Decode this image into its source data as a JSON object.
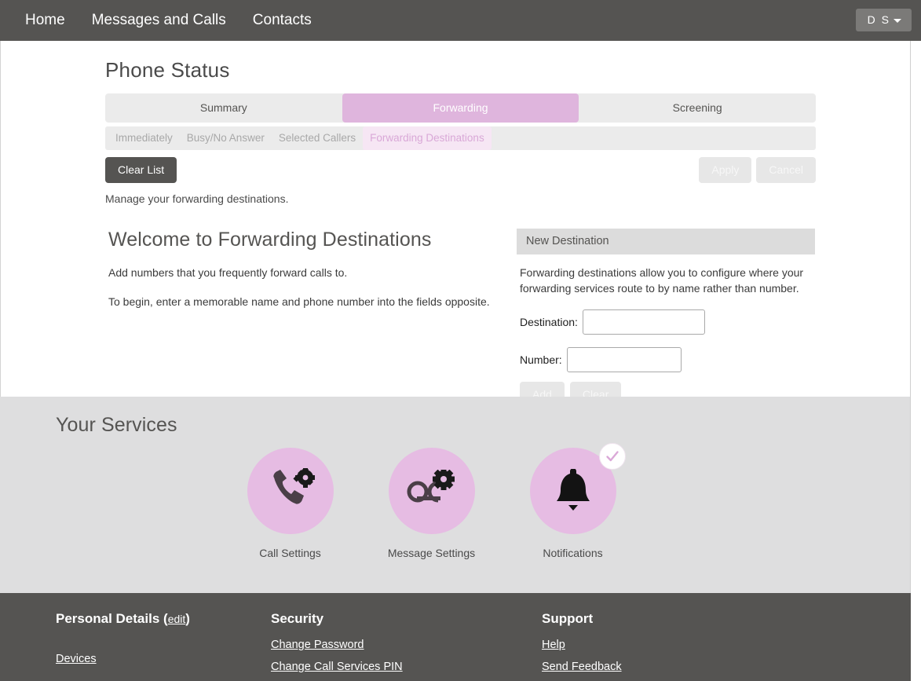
{
  "nav": {
    "links": [
      {
        "label": "Home"
      },
      {
        "label": "Messages and Calls"
      },
      {
        "label": "Contacts"
      }
    ],
    "user_initials": "D S"
  },
  "page": {
    "title": "Phone Status",
    "tabs": [
      {
        "label": "Summary",
        "active": false
      },
      {
        "label": "Forwarding",
        "active": true
      },
      {
        "label": "Screening",
        "active": false
      }
    ],
    "subtabs": [
      {
        "label": "Immediately",
        "active": false
      },
      {
        "label": "Busy/No Answer",
        "active": false
      },
      {
        "label": "Selected Callers",
        "active": false
      },
      {
        "label": "Forwarding Destinations",
        "active": true
      }
    ],
    "clear_list_label": "Clear List",
    "apply_label": "Apply",
    "cancel_label": "Cancel",
    "hint": "Manage your forwarding destinations."
  },
  "welcome": {
    "heading": "Welcome to Forwarding Destinations",
    "line1": "Add numbers that you frequently forward calls to.",
    "line2": "To begin, enter a memorable name and phone number into the fields opposite."
  },
  "new_destination": {
    "panel_title": "New Destination",
    "description": "Forwarding destinations allow you to configure where your forwarding services route to by name rather than number.",
    "destination_label": "Destination:",
    "destination_value": "",
    "number_label": "Number:",
    "number_value": "",
    "add_label": "Add",
    "clear_label": "Clear"
  },
  "services": {
    "title": "Your Services",
    "tiles": [
      {
        "label": "Call Settings",
        "icon": "phone-gear-icon",
        "badge": false
      },
      {
        "label": "Message Settings",
        "icon": "voicemail-gear-icon",
        "badge": false
      },
      {
        "label": "Notifications",
        "icon": "bell-icon",
        "badge": true
      }
    ]
  },
  "footer": {
    "columns": [
      {
        "heading": "Personal Details",
        "edit_label": "edit",
        "links": [
          {
            "label": "Devices"
          }
        ]
      },
      {
        "heading": "Security",
        "links": [
          {
            "label": "Change Password"
          },
          {
            "label": "Change Call Services PIN"
          }
        ]
      },
      {
        "heading": "Support",
        "links": [
          {
            "label": "Help"
          },
          {
            "label": "Send Feedback"
          }
        ]
      }
    ]
  },
  "colors": {
    "accent": "#dfb5dd",
    "tile": "#e6bce3",
    "dark": "#555452",
    "band": "#dededf"
  }
}
